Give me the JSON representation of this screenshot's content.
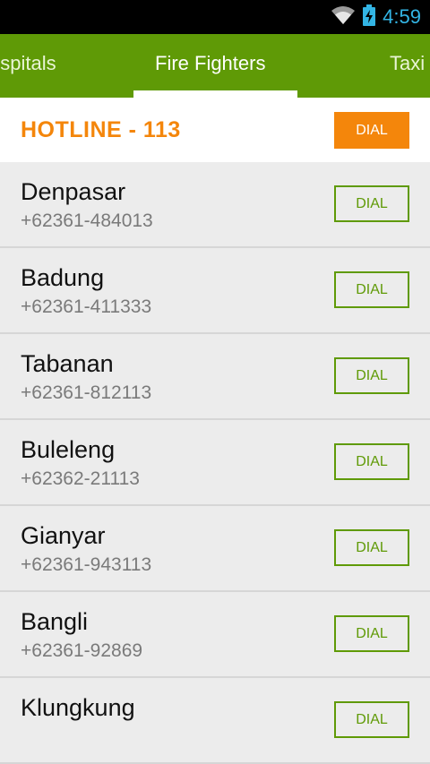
{
  "status_bar": {
    "time": "4:59",
    "wifi_icon": "wifi-icon",
    "battery_icon": "battery-charging-icon",
    "time_color": "#33b5e5"
  },
  "tabs": [
    {
      "label": "ospitals"
    },
    {
      "label": "Fire Fighters",
      "selected": true
    },
    {
      "label": "Taxi"
    }
  ],
  "colors": {
    "tab_bar": "#5f9a06",
    "accent_orange": "#f4860b",
    "dial_outline": "#5f9a06",
    "list_bg": "#ececec"
  },
  "hotline": {
    "label": "HOTLINE - 113",
    "dial_label": "DIAL"
  },
  "contacts": [
    {
      "name": "Denpasar",
      "phone": "+62361-484013",
      "dial_label": "DIAL"
    },
    {
      "name": "Badung",
      "phone": "+62361-411333",
      "dial_label": "DIAL"
    },
    {
      "name": "Tabanan",
      "phone": "+62361-812113",
      "dial_label": "DIAL"
    },
    {
      "name": "Buleleng",
      "phone": "+62362-21113",
      "dial_label": "DIAL"
    },
    {
      "name": "Gianyar",
      "phone": "+62361-943113",
      "dial_label": "DIAL"
    },
    {
      "name": "Bangli",
      "phone": "+62361-92869",
      "dial_label": "DIAL"
    },
    {
      "name": "Klungkung",
      "phone": "",
      "dial_label": "DIAL"
    }
  ]
}
